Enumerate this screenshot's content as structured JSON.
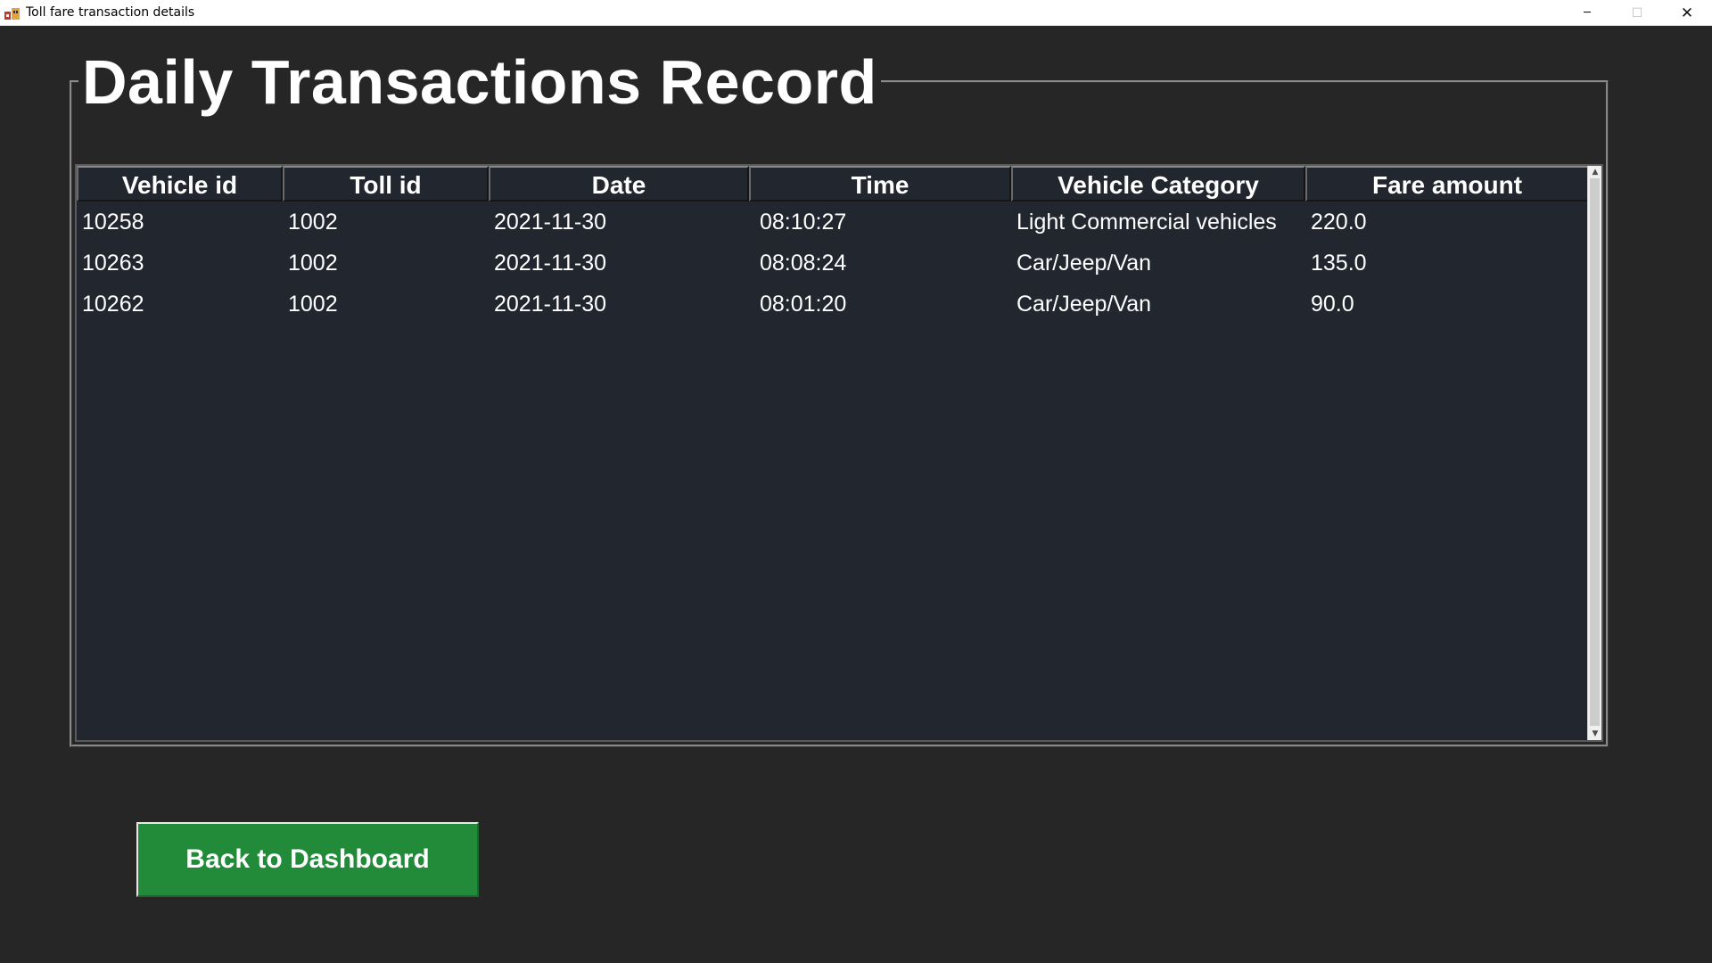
{
  "window": {
    "title": "Toll fare transaction details",
    "controls": {
      "minimize": "─",
      "maximize": "☐",
      "close": "✕"
    }
  },
  "frame": {
    "title": "Daily Transactions Record"
  },
  "table": {
    "columns": [
      "Vehicle id",
      "Toll id",
      "Date",
      "Time",
      "Vehicle Category",
      "Fare amount"
    ],
    "rows": [
      [
        "10258",
        "1002",
        "2021-11-30",
        "08:10:27",
        "Light Commercial vehicles",
        "220.0"
      ],
      [
        "10263",
        "1002",
        "2021-11-30",
        "08:08:24",
        "Car/Jeep/Van",
        "135.0"
      ],
      [
        "10262",
        "1002",
        "2021-11-30",
        "08:01:20",
        "Car/Jeep/Van",
        "90.0"
      ]
    ]
  },
  "actions": {
    "back_label": "Back to Dashboard"
  },
  "colors": {
    "background": "#262626",
    "table_background": "#22262e",
    "button": "#228b3a",
    "text": "#ffffff"
  }
}
